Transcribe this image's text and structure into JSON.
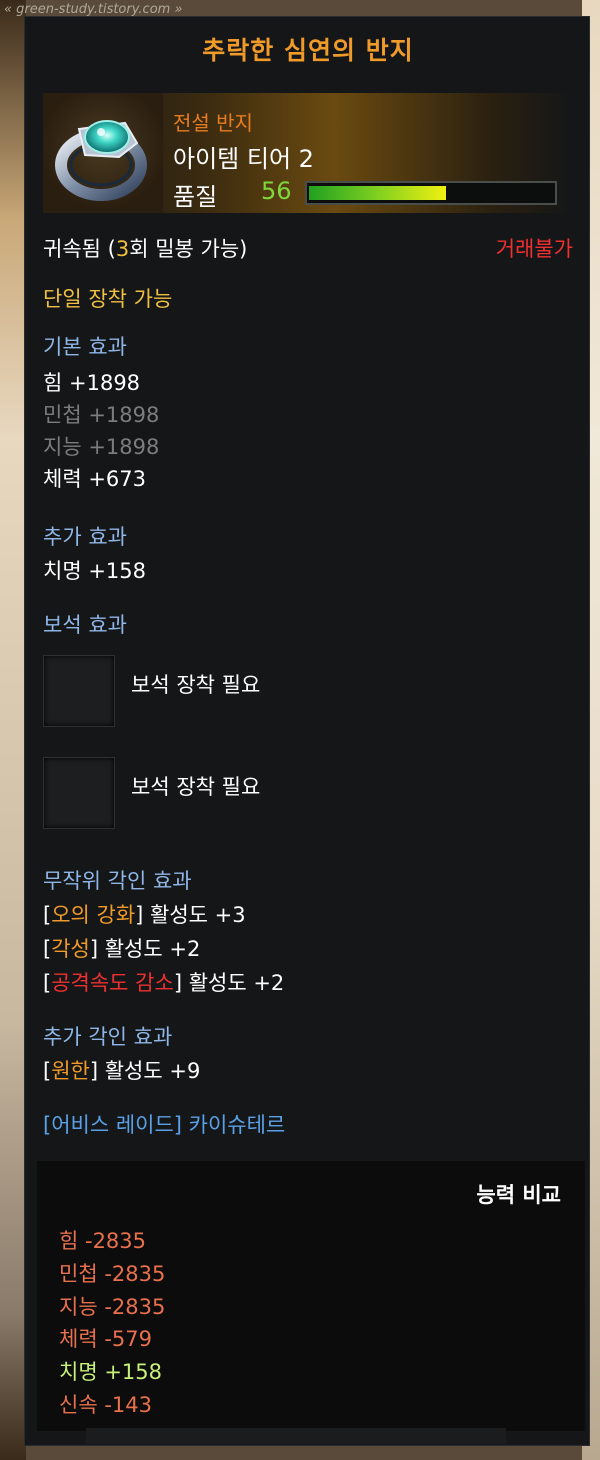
{
  "watermark": "« green-study.tistory.com »",
  "item": {
    "name": "추락한 심연의 반지",
    "grade": "전설 반지",
    "tier": "아이템 티어 2",
    "quality_label": "품질",
    "quality_value": "56",
    "quality_percent": 56,
    "icon": "ring-icon",
    "colors": {
      "title": "#f09a2a",
      "quality": "#7ed83a",
      "section": "#8fb6e6"
    }
  },
  "binding": {
    "bound_prefix": "귀속됨 (",
    "bound_count": "3",
    "bound_suffix": "회 밀봉 가능)",
    "trade": "거래불가"
  },
  "equip_limit": "단일 장착 가능",
  "base_effect": {
    "heading": "기본 효과",
    "stats": [
      {
        "text": "힘 +1898",
        "active": true
      },
      {
        "text": "민첩 +1898",
        "active": false
      },
      {
        "text": "지능 +1898",
        "active": false
      },
      {
        "text": "체력 +673",
        "active": true
      }
    ]
  },
  "extra_effect": {
    "heading": "추가 효과",
    "stats": [
      "치명 +158"
    ]
  },
  "gem_effect": {
    "heading": "보석 효과",
    "slots": [
      {
        "label": "보석 장착 필요"
      },
      {
        "label": "보석 장착 필요"
      }
    ]
  },
  "random_engraving": {
    "heading": "무작위 각인 효과",
    "lines": [
      {
        "name": "오의 강화",
        "activation": "활성도 +3"
      },
      {
        "name": "각성",
        "activation": "활성도 +2"
      },
      {
        "name": "공격속도 감소",
        "activation": "활성도 +2"
      }
    ]
  },
  "extra_engraving": {
    "heading": "추가 각인 효과",
    "lines": [
      {
        "name": "원한",
        "activation": "활성도 +9"
      }
    ]
  },
  "source": "[어비스 레이드] 카이슈테르",
  "compare": {
    "title": "능력 비교",
    "lines": [
      {
        "text": "힘 -2835",
        "positive": false
      },
      {
        "text": "민첩 -2835",
        "positive": false
      },
      {
        "text": "지능 -2835",
        "positive": false
      },
      {
        "text": "체력 -579",
        "positive": false
      },
      {
        "text": "치명 +158",
        "positive": true
      },
      {
        "text": "신속 -143",
        "positive": false
      }
    ]
  }
}
